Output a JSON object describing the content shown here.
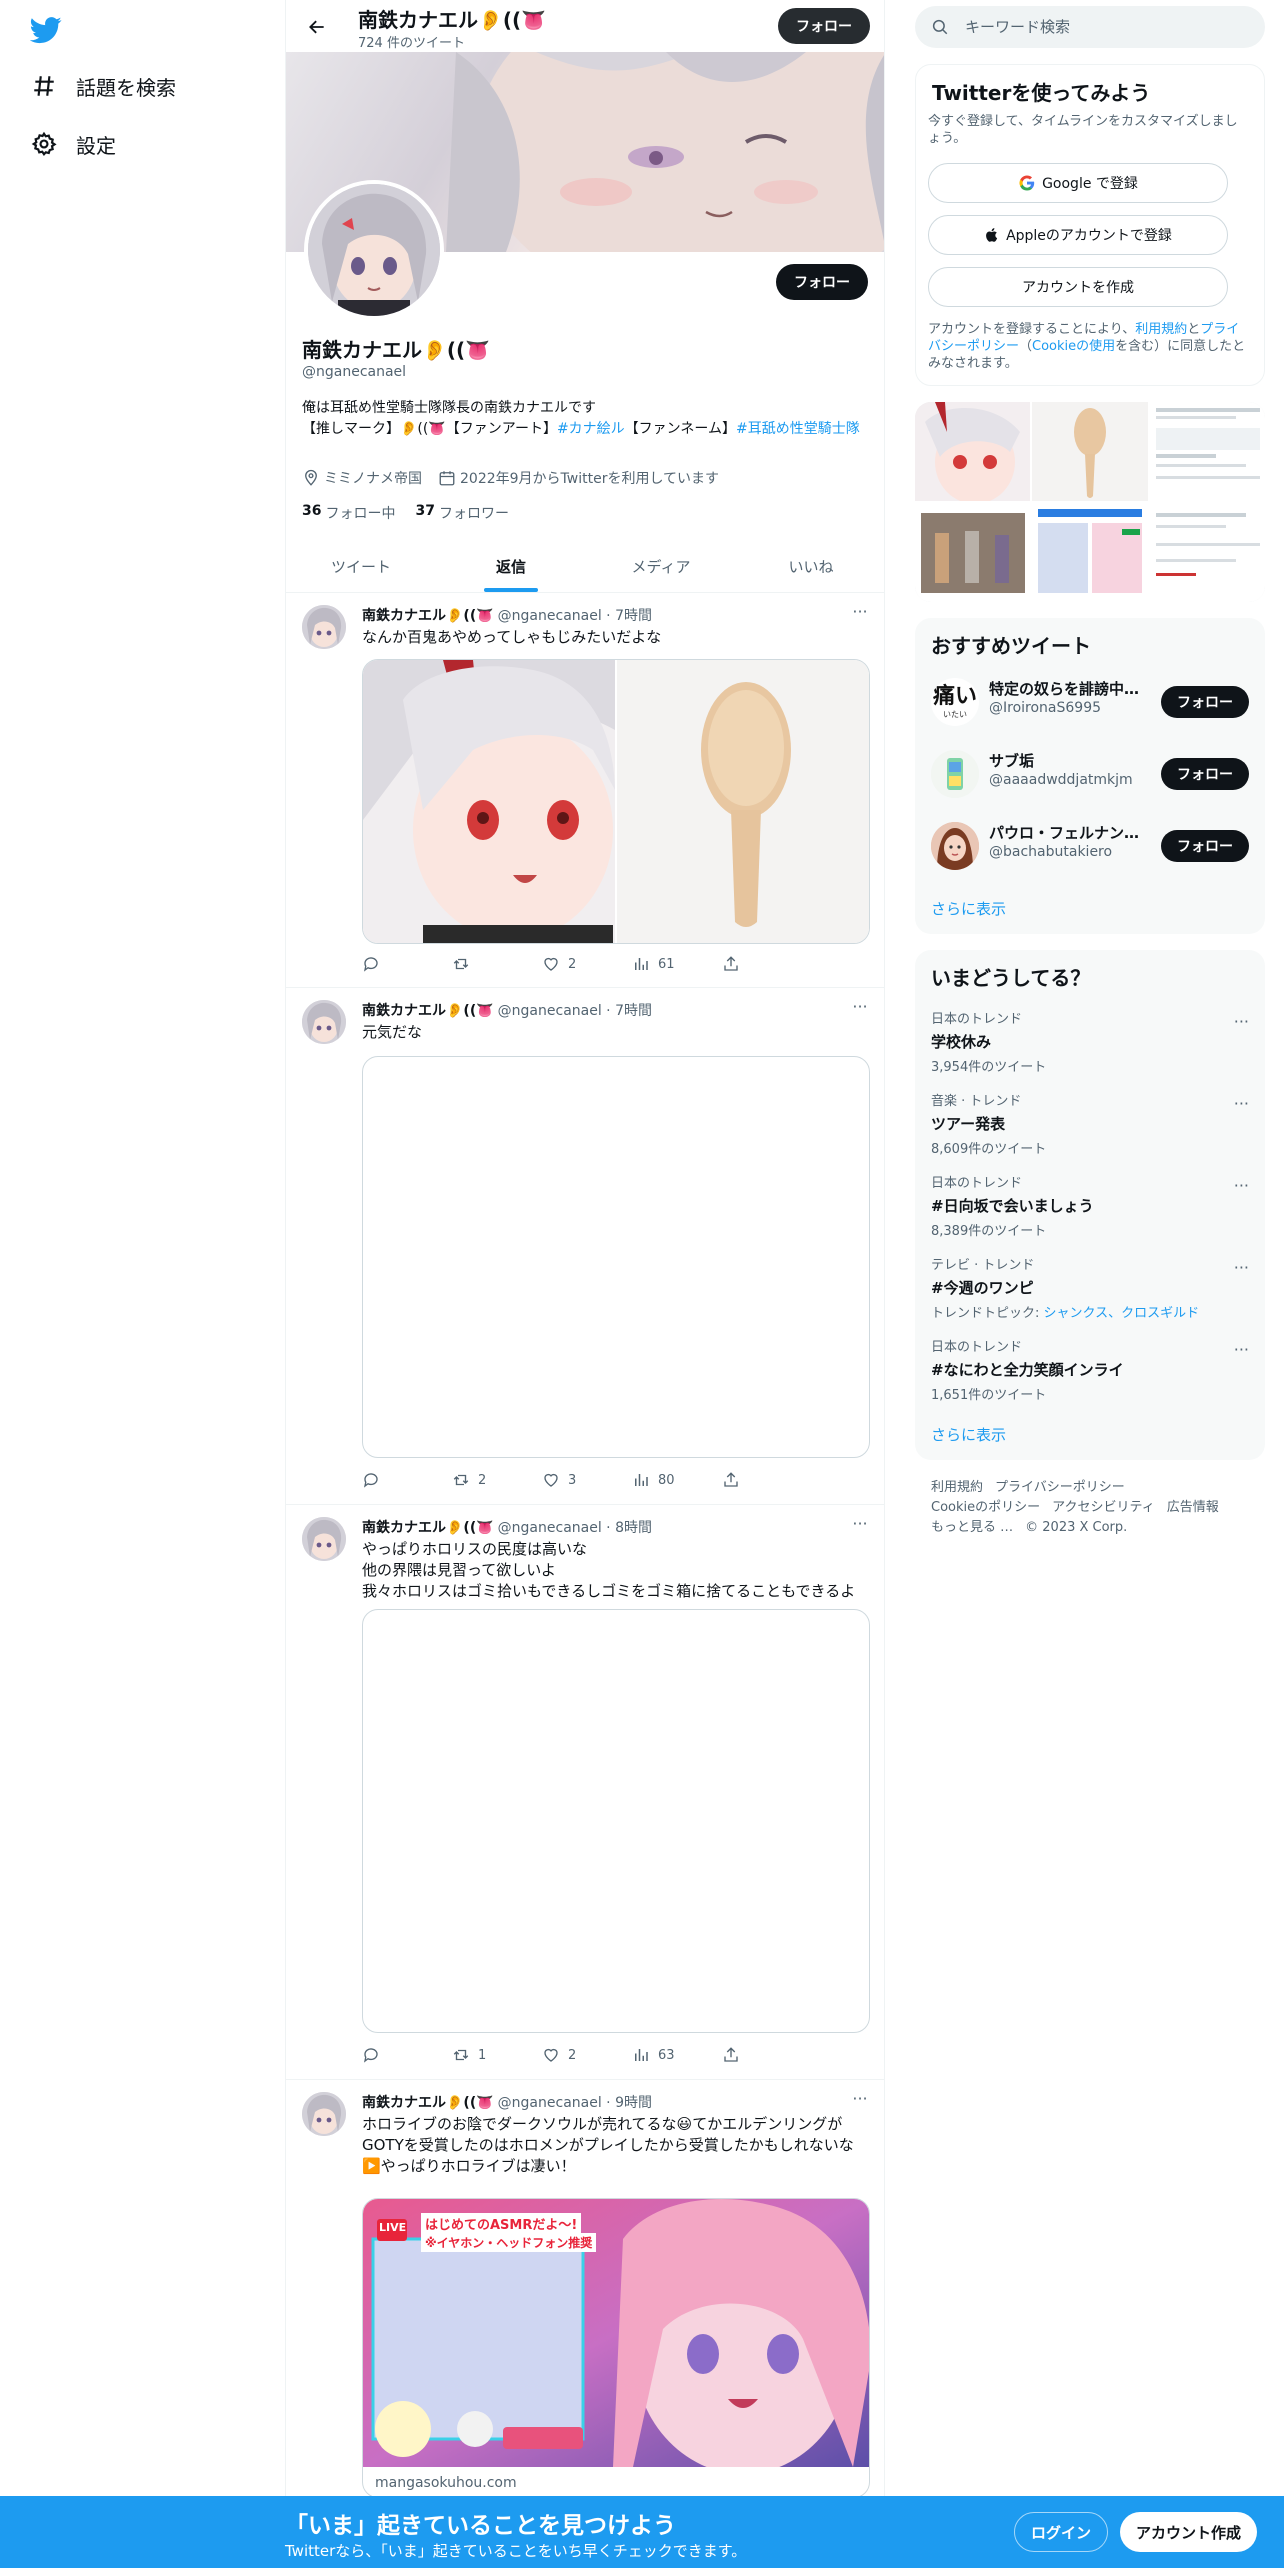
{
  "nav": {
    "items": [
      {
        "label": "話題を検索",
        "icon": "hashtag-icon"
      },
      {
        "label": "設定",
        "icon": "gear-icon"
      }
    ]
  },
  "header": {
    "name": "南鉄カナエル👂((👅",
    "tweet_count": "724 件のツイート",
    "follow_label": "フォロー"
  },
  "profile": {
    "name": "南鉄カナエル👂((👅",
    "handle": "@nganecanael",
    "follow_label": "フォロー",
    "bio_line1": "俺は耳舐め性堂騎士隊隊長の南鉄カナエルです",
    "bio_line2a": "【推しマーク】👂((👅【ファンアート】",
    "bio_tag1": "#カナ絵ル",
    "bio_line2b": "【ファンネーム】",
    "bio_tag2": "#耳舐め性堂騎士隊",
    "location": "ミミノナメ帝国",
    "joined": "2022年9月からTwitterを利用しています",
    "following_count": "36",
    "following_label": "フォロー中",
    "followers_count": "37",
    "followers_label": "フォロワー"
  },
  "tabs": [
    {
      "label": "ツイート",
      "active": false
    },
    {
      "label": "返信",
      "active": true
    },
    {
      "label": "メディア",
      "active": false
    },
    {
      "label": "いいね",
      "active": false
    }
  ],
  "tweets": [
    {
      "name": "南鉄カナエル👂((👅",
      "handle": "@nganecanael · 7時間",
      "text": "なんか百鬼あやめってしゃもじみたいだよな",
      "reply": "",
      "retweet": "",
      "like": "2",
      "views": "61"
    },
    {
      "name": "南鉄カナエル👂((👅",
      "handle": "@nganecanael · 7時間",
      "text": "元気だな",
      "reply": "",
      "retweet": "2",
      "like": "3",
      "views": "80"
    },
    {
      "name": "南鉄カナエル👂((👅",
      "handle": "@nganecanael · 8時間",
      "text1": "やっぱりホロリスの民度は高いな",
      "text2": "他の界隈は見習って欲しいよ",
      "text3": "我々ホロリスはゴミ拾いもできるしゴミをゴミ箱に捨てることもできるよ",
      "reply": "",
      "retweet": "1",
      "like": "2",
      "views": "63"
    },
    {
      "name": "南鉄カナエル👂((👅",
      "handle": "@nganecanael · 9時間",
      "text1": "ホロライブのお陰でダークソウルが売れてるな😃てかエルデンリングが",
      "text2": "GOTYを受賞したのはホロメンがプレイしたから受賞したかもしれないな",
      "text3": "▶️やっぱりホロライブは凄い！",
      "card_domain": "mangasokuhou.com",
      "card_text_top": "はじめてのASMRだよ～!",
      "card_text_sub": "※イヤホン・ヘッドフォン推奨",
      "card_live": "LIVE"
    }
  ],
  "search": {
    "placeholder": "キーワード検索"
  },
  "signup": {
    "title": "Twitterを使ってみよう",
    "subtitle": "今すぐ登録して、タイムラインをカスタマイズしましょう。",
    "google": "Google で登録",
    "apple": "Appleのアカウントで登録",
    "create": "アカウントを作成",
    "terms1": "アカウントを登録することにより、",
    "terms_link1": "利用規約",
    "terms2": "と",
    "terms_link2": "プライバシーポリシー",
    "terms3": "（",
    "terms_link3": "Cookieの使用",
    "terms4": "を含む）に同意したとみなされます。"
  },
  "recommended": {
    "title": "おすすめツイート",
    "users": [
      {
        "name": "特定の奴らを誹謗中…",
        "handle": "@IroironaS6995",
        "avatar_text": "痛い",
        "avatar_sub": "いたい"
      },
      {
        "name": "サブ垢",
        "handle": "@aaaadwddjatmkjm"
      },
      {
        "name": "パウロ・フェルナン…",
        "handle": "@bachabutakiero"
      }
    ],
    "follow_label": "フォロー",
    "show_more": "さらに表示"
  },
  "trends": {
    "title": "いまどうしてる？",
    "items": [
      {
        "context": "日本のトレンド",
        "title": "学校休み",
        "count": "3,954件のツイート"
      },
      {
        "context": "音楽 · トレンド",
        "title": "ツアー発表",
        "count": "8,609件のツイート"
      },
      {
        "context": "日本のトレンド",
        "title": "#日向坂で会いましょう",
        "count": "8,389件のツイート"
      },
      {
        "context": "テレビ · トレンド",
        "title": "#今週のワンピ",
        "count_prefix": "トレンドトピック: ",
        "count_link": "シャンクス、クロスギルド"
      },
      {
        "context": "日本のトレンド",
        "title": "#なにわと全力笑顔インライ",
        "count": "1,651件のツイート"
      }
    ],
    "show_more": "さらに表示"
  },
  "footer": {
    "links": [
      "利用規約",
      "プライバシーポリシー",
      "Cookieのポリシー",
      "アクセシビリティ",
      "広告情報",
      "もっと見る …",
      "© 2023 X Corp."
    ]
  },
  "bottom": {
    "title": "「いま」起きていることを見つけよう",
    "subtitle": "Twitterなら、「いま」起きていることをいち早くチェックできます。",
    "login": "ログイン",
    "signup": "アカウント作成"
  },
  "colors": {
    "accent": "#1d9bf0",
    "text": "#0f1419",
    "muted": "#536471"
  }
}
